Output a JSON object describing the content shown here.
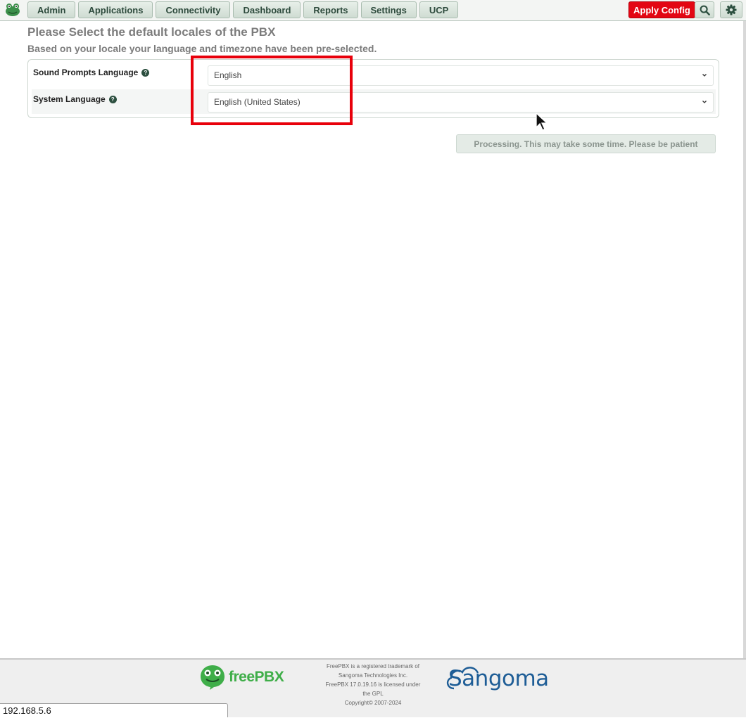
{
  "nav": {
    "items": [
      "Admin",
      "Applications",
      "Connectivity",
      "Dashboard",
      "Reports",
      "Settings",
      "UCP"
    ],
    "apply_label": "Apply Config"
  },
  "page": {
    "heading": "Please Select the default locales of the PBX",
    "subheading": "Based on your locale your language and timezone have been pre-selected."
  },
  "form": {
    "sound_label": "Sound Prompts Language",
    "sound_value": "English",
    "system_label": "System Language",
    "system_value": "English (United States)"
  },
  "processing_label": "Processing. This may take some time. Please be patient",
  "footer": {
    "brand": "freePBX",
    "legal_lines": [
      "FreePBX is a registered trademark of",
      "Sangoma Technologies Inc.",
      "FreePBX 17.0.19.16 is licensed under",
      "the GPL",
      "Copyright© 2007-2024"
    ],
    "sangoma": "Sangoma"
  },
  "status_url": "192.168.5.6",
  "colors": {
    "apply": "#e30613",
    "highlight": "#e8000b",
    "brand_green": "#3fae49",
    "sangoma_blue": "#1e5d96"
  },
  "icons": [
    "frog-logo-icon",
    "search-icon",
    "gear-icon",
    "help-icon",
    "chevron-down-icon",
    "mouse-cursor-icon"
  ]
}
